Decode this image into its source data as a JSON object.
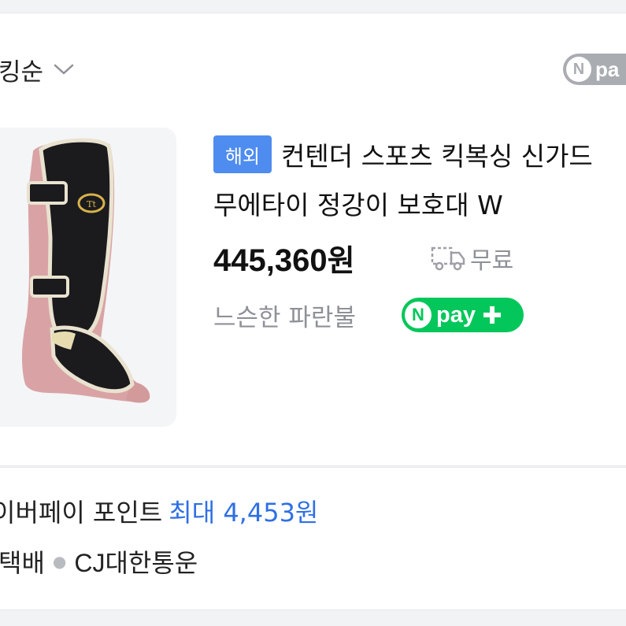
{
  "sort": {
    "label": "킹순",
    "icon": "chevron-down-icon"
  },
  "filter": {
    "npay_label": "pa",
    "npay_circle": "N"
  },
  "product": {
    "badge": "해외",
    "title": "컨텐더 스포츠 킥복싱 신가드 무에타이 정강이 보호대 W",
    "price_number": "445,360",
    "price_unit": "원",
    "shipping": "무료",
    "seller": "느슨한 파란불",
    "npay_circle": "N",
    "npay_label": "pay"
  },
  "benefits": {
    "points_label": "이버페이 포인트",
    "points_value": "최대 4,453원",
    "delivery_label": "택배",
    "carrier": "CJ대한통운"
  },
  "colors": {
    "accent_blue": "#2f6fe4",
    "badge_blue": "#4e8cf0",
    "npay_green": "#03c75a",
    "muted_gray": "#8e9197"
  }
}
